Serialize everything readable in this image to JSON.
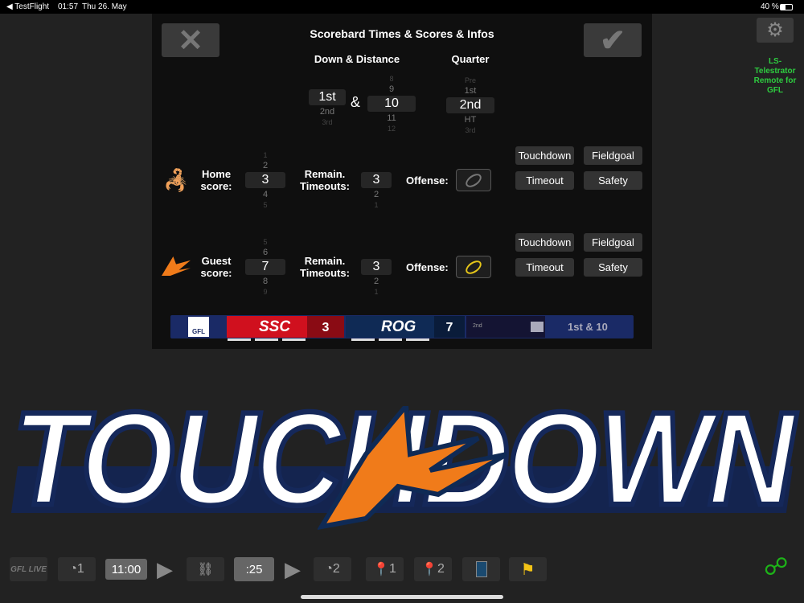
{
  "status": {
    "back": "◀ TestFlight",
    "time": "01:57",
    "date": "Thu 26. May",
    "battery": "40 %"
  },
  "dialog": {
    "title": "Scorebard Times & Scores & Infos",
    "cancel_icon": "x-icon",
    "confirm_icon": "check-icon",
    "down_distance_label": "Down & Distance",
    "quarter_label": "Quarter",
    "amp": "&",
    "downs": {
      "above2": "",
      "above1": "",
      "selected": "1st",
      "below1": "2nd",
      "below2": "3rd"
    },
    "distance": {
      "above2": "8",
      "above1": "9",
      "selected": "10",
      "below1": "11",
      "below2": "12"
    },
    "quarter": {
      "above2": "Pre",
      "above1": "1st",
      "selected": "2nd",
      "below1": "HT",
      "below2": "3rd"
    }
  },
  "home": {
    "score_label": "Home score:",
    "timeouts_label": "Remain. Timeouts:",
    "offense_label": "Offense:",
    "score": {
      "above2": "1",
      "above1": "2",
      "selected": "3",
      "below1": "4",
      "below2": "5"
    },
    "timeouts": {
      "above1": "",
      "selected": "3",
      "below1": "2",
      "below2": "1"
    },
    "offense_active": false,
    "buttons": [
      "Touchdown",
      "Fieldgoal",
      "Timeout",
      "Safety"
    ]
  },
  "guest": {
    "score_label": "Guest score:",
    "timeouts_label": "Remain. Timeouts:",
    "offense_label": "Offense:",
    "score": {
      "above2": "5",
      "above1": "6",
      "selected": "7",
      "below1": "8",
      "below2": "9"
    },
    "timeouts": {
      "above1": "",
      "selected": "3",
      "below1": "2",
      "below2": "1"
    },
    "offense_active": true,
    "buttons": [
      "Touchdown",
      "Fieldgoal",
      "Timeout",
      "Safety"
    ]
  },
  "scoreboard": {
    "league": "GFL",
    "home_abbr": "SSC",
    "home_score": "3",
    "guest_abbr": "ROG",
    "guest_score": "7",
    "quarter": "2nd",
    "down_distance": "1st & 10",
    "home_color": "#d0101e",
    "guest_color": "#0f2a55"
  },
  "side": {
    "settings_icon": "gear-icon",
    "app_name": "LS-Telestrator Remote for GFL",
    "app_color": "#2ecc40"
  },
  "banner": {
    "text": "TOUCHDOWN"
  },
  "toolbar": {
    "live": "GFL LIVE",
    "timeout1": "1",
    "clock": "11:00",
    "playclock": ":25",
    "timeout2": "2",
    "marker1": "1",
    "marker2": "2"
  }
}
